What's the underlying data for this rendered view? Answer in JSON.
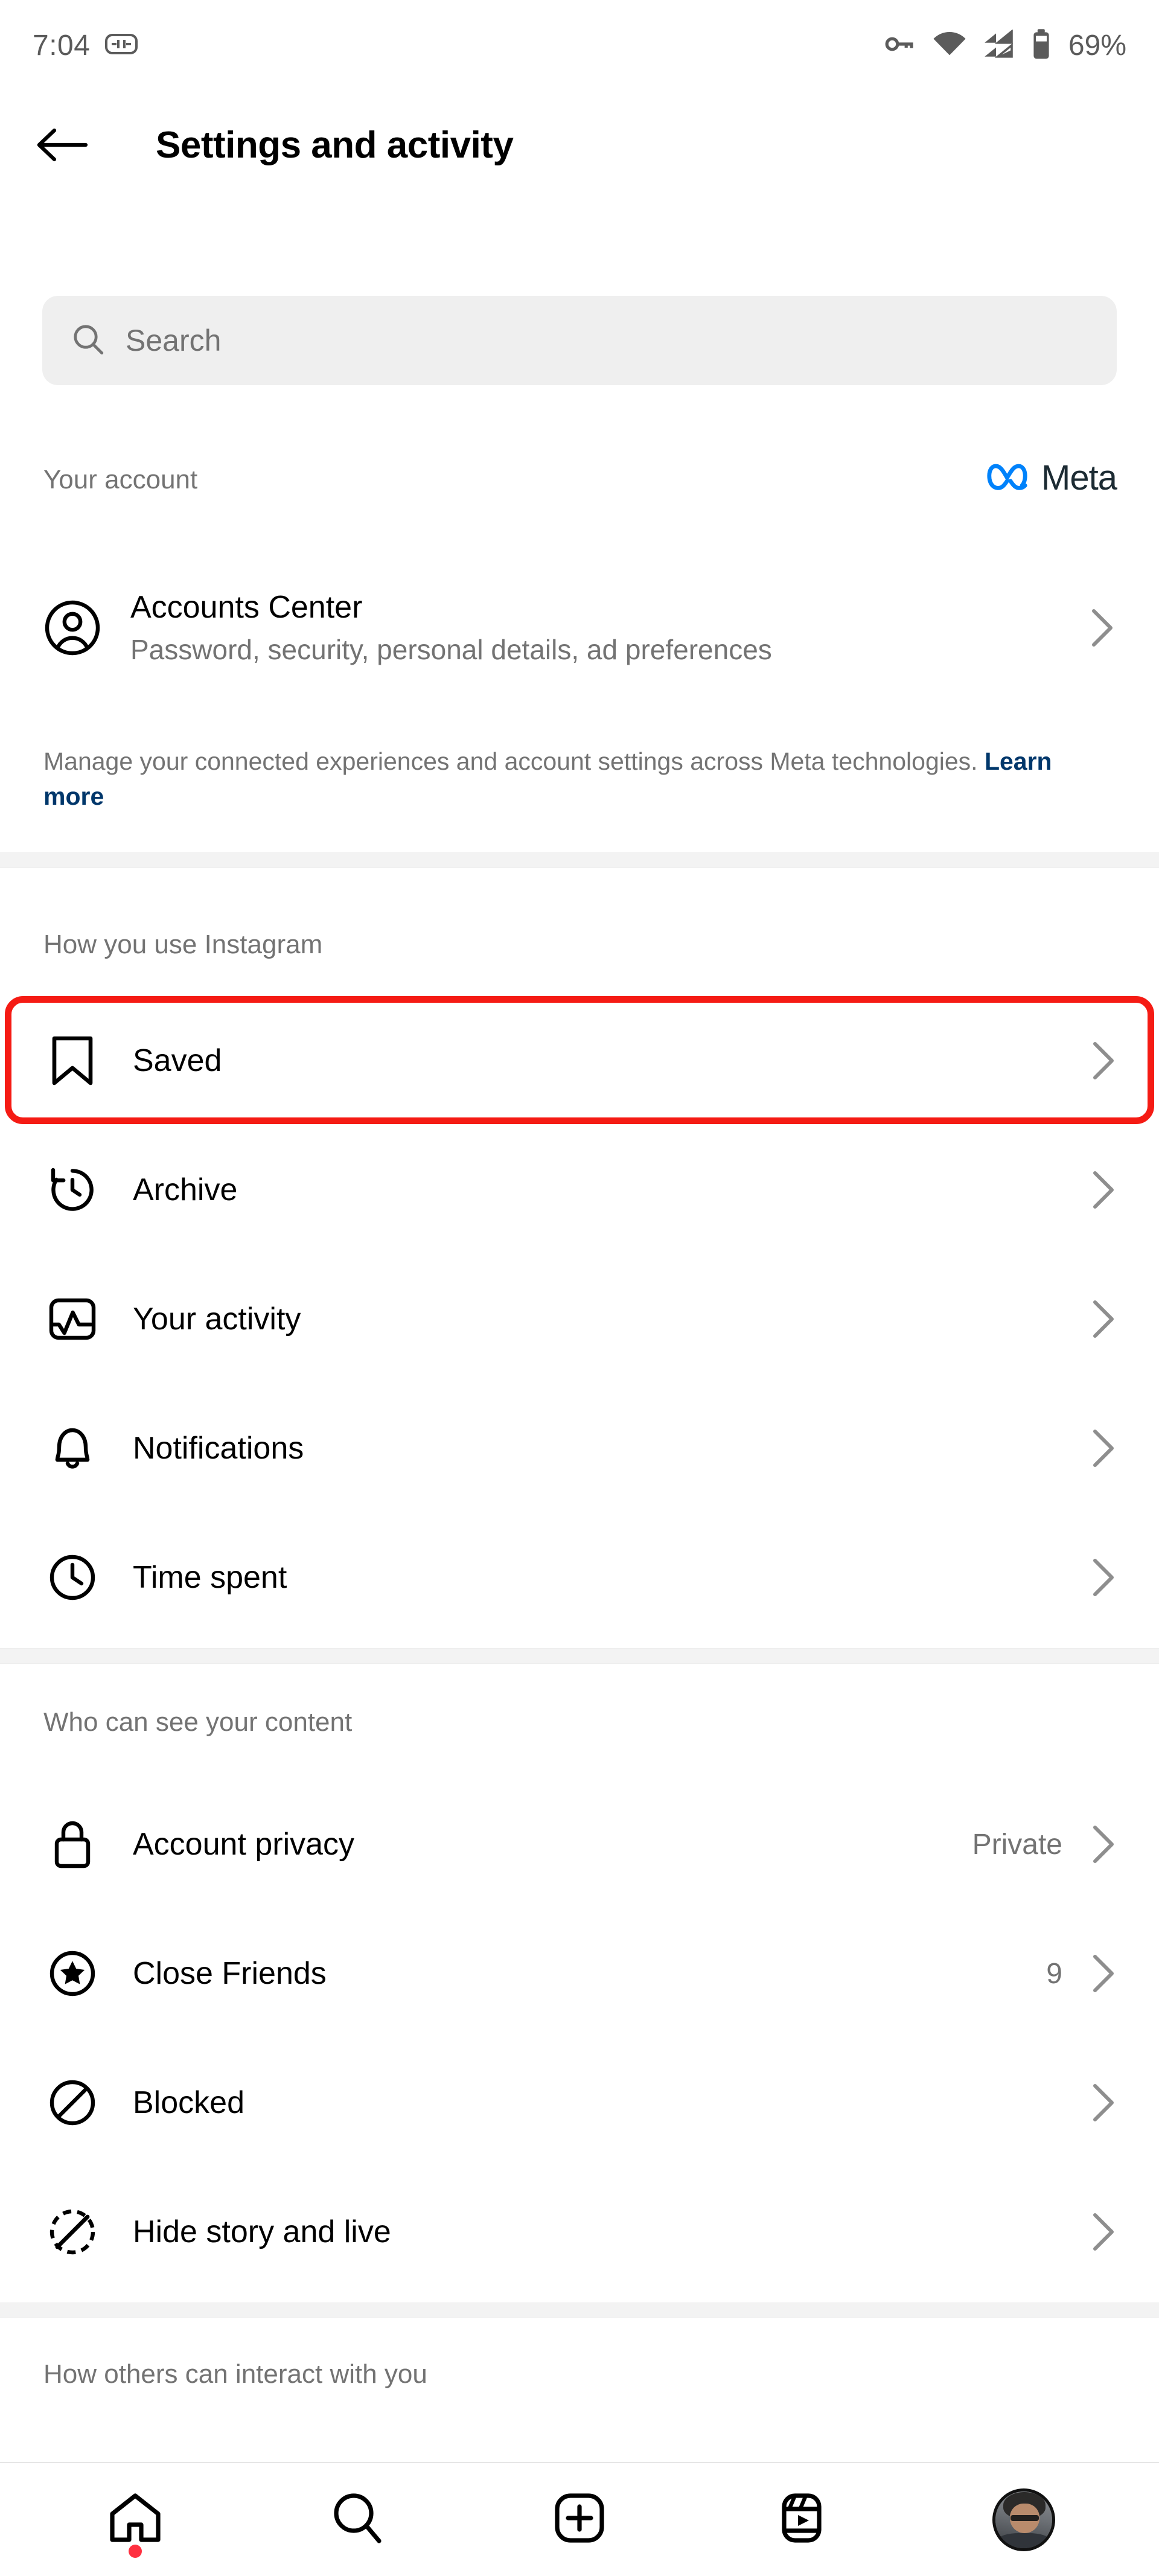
{
  "status_bar": {
    "time": "7:04",
    "battery_percent": "69%",
    "icons": [
      "screen-record-icon",
      "vpn-key-icon",
      "wifi-icon",
      "cellular-signal-icon",
      "battery-icon"
    ]
  },
  "header": {
    "back_label": "Back",
    "title": "Settings and activity"
  },
  "search": {
    "placeholder": "Search",
    "value": ""
  },
  "your_account": {
    "label": "Your account",
    "brand": "Meta",
    "row": {
      "title": "Accounts Center",
      "subtitle": "Password, security, personal details, ad preferences"
    },
    "description_prefix": "Manage your connected experiences and account settings across Meta technologies. ",
    "learn_more": "Learn more"
  },
  "sections": [
    {
      "label": "How you use Instagram",
      "items": [
        {
          "icon": "bookmark-icon",
          "label": "Saved",
          "value": "",
          "highlighted": true
        },
        {
          "icon": "archive-clock-icon",
          "label": "Archive",
          "value": "",
          "highlighted": false
        },
        {
          "icon": "activity-chart-icon",
          "label": "Your activity",
          "value": "",
          "highlighted": false
        },
        {
          "icon": "bell-icon",
          "label": "Notifications",
          "value": "",
          "highlighted": false
        },
        {
          "icon": "clock-icon",
          "label": "Time spent",
          "value": "",
          "highlighted": false
        }
      ]
    },
    {
      "label": "Who can see your content",
      "items": [
        {
          "icon": "lock-icon",
          "label": "Account privacy",
          "value": "Private",
          "highlighted": false
        },
        {
          "icon": "star-circle-icon",
          "label": "Close Friends",
          "value": "9",
          "highlighted": false
        },
        {
          "icon": "block-icon",
          "label": "Blocked",
          "value": "",
          "highlighted": false
        },
        {
          "icon": "hide-story-icon",
          "label": "Hide story and live",
          "value": "",
          "highlighted": false
        }
      ]
    },
    {
      "label": "How others can interact with you",
      "items": []
    }
  ],
  "bottom_nav": [
    {
      "icon": "home-icon",
      "label": "Home",
      "badge": true
    },
    {
      "icon": "search-icon",
      "label": "Search",
      "badge": false
    },
    {
      "icon": "create-icon",
      "label": "Create",
      "badge": false
    },
    {
      "icon": "reels-icon",
      "label": "Reels",
      "badge": false
    },
    {
      "icon": "profile-avatar",
      "label": "Profile",
      "badge": false
    }
  ],
  "colors": {
    "accent_red": "#f51b14",
    "meta_blue": "#0082fb",
    "link_blue": "#00376b",
    "muted": "#737373",
    "divider": "#f3f3f3",
    "search_bg": "#efefef",
    "notification_dot": "#ff3040"
  }
}
